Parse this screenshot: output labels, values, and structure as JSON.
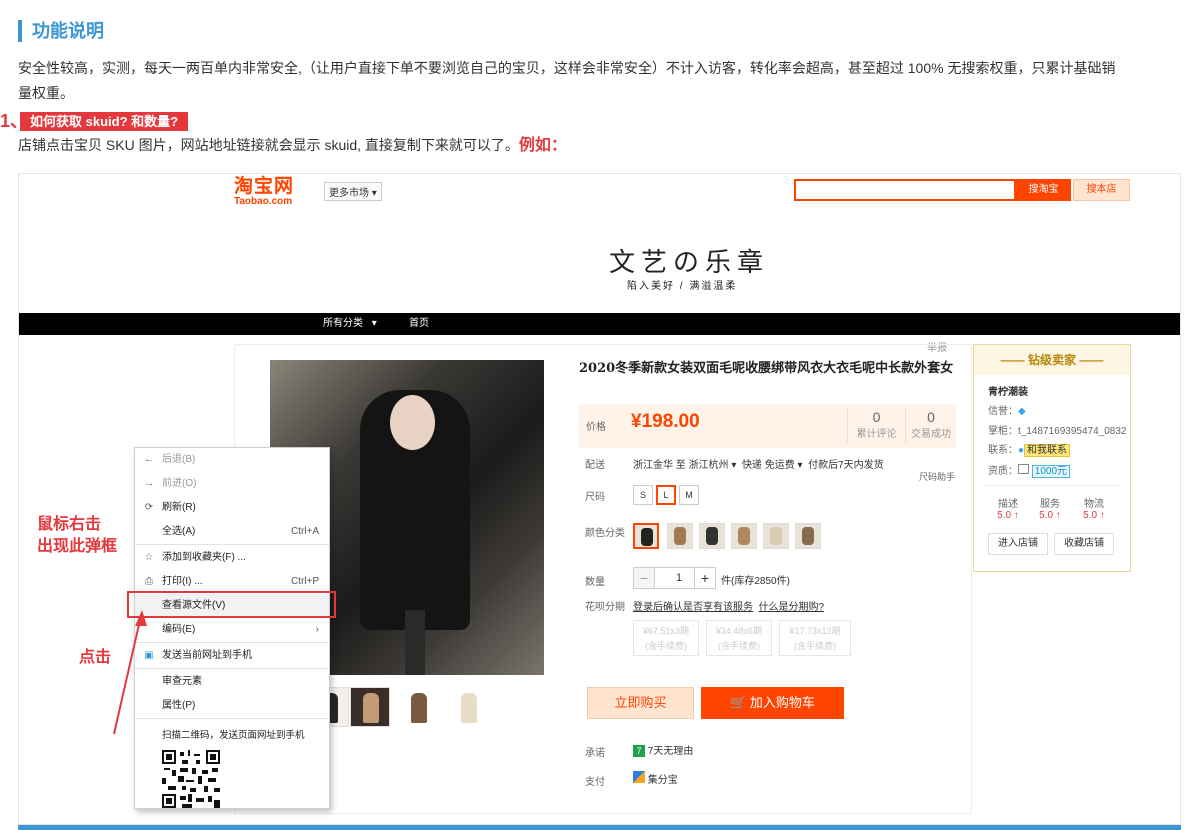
{
  "section": {
    "title": "功能说明",
    "paragraph": "安全性较高，实测，每天一两百单内非常安全,（让用户直接下单不要浏览自己的宝贝，这样会非常安全）不计入访客，转化率会超高，甚至超过 100% 无搜索权重，只累计基础销量权重。",
    "step_number": "1、",
    "step_badge": "如何获取 skuid? 和数量?",
    "step_text": "店铺点击宝贝 SKU 图片，网站地址链接就会显示 skuid, 直接复制下来就可以了。",
    "example_label": "例如："
  },
  "taobao": {
    "logo_cn": "淘宝网",
    "logo_en": "Taobao.com",
    "more_market": "更多市场",
    "search_placeholder": "",
    "search_button": "搜淘宝",
    "store_button": "搜本店",
    "shop_name": "文艺の乐章",
    "shop_slogan": "陷入美好 / 满溢温柔",
    "nav": [
      "所有分类",
      "首页"
    ],
    "report": "举报"
  },
  "product": {
    "title": "2020冬季新款女装双面毛呢收腰绑带风衣大衣毛呢中长款外套女",
    "price_label": "价格",
    "price": "¥198.00",
    "review_count": "0",
    "review_label": "累计评论",
    "sales_count": "0",
    "sales_label": "交易成功",
    "delivery_label": "配送",
    "delivery_from": "浙江金华 至",
    "delivery_to": "浙江杭州",
    "delivery_express": "快递 免运费",
    "delivery_time": "付款后7天内发货",
    "size_helper": "尺码助手",
    "size_label": "尺码",
    "sizes": [
      "S",
      "L",
      "M"
    ],
    "color_label": "颜色分类",
    "qty_label": "数量",
    "qty_minus": "−",
    "qty_value": "1",
    "qty_plus": "+",
    "qty_stock": "件(库存2850件)",
    "installment_label": "花呗分期",
    "installment_text": "登录后确认是否享有该服务",
    "installment_link": "什么是分期购?",
    "installments": [
      {
        "amount": "¥67.51x3期",
        "fee": "(含手续费)"
      },
      {
        "amount": "¥34.48x6期",
        "fee": "(含手续费)"
      },
      {
        "amount": "¥17.73x12期",
        "fee": "(含手续费)"
      }
    ],
    "buy_now": "立即购买",
    "add_cart": "加入购物车",
    "promise_label": "承诺",
    "promise_text": "7天无理由",
    "pay_label": "支付",
    "pay_text": "集分宝"
  },
  "seller": {
    "header": "钻级卖家",
    "name": "青柠潮装",
    "credit_label": "信誉：",
    "owner_label": "掌柜：",
    "owner_value": "t_1487169395474_0832",
    "contact_label": "联系：",
    "contact_value": "和我联系",
    "qual_label": "资质：",
    "qual_value": "1000元",
    "scores": [
      {
        "label": "描述",
        "value": "5.0 ↑"
      },
      {
        "label": "服务",
        "value": "5.0 ↑"
      },
      {
        "label": "物流",
        "value": "5.0 ↑"
      }
    ],
    "enter_store": "进入店铺",
    "fav_store": "收藏店铺"
  },
  "context_menu": {
    "items": [
      {
        "icon": "←",
        "label": "后退(B)"
      },
      {
        "icon": "→",
        "label": "前进(O)"
      },
      {
        "icon": "⟳",
        "label": "刷新(R)"
      },
      {
        "label": "全选(A)",
        "shortcut": "Ctrl+A"
      },
      {
        "icon": "☆",
        "label": "添加到收藏夹(F) ..."
      },
      {
        "icon": "⎙",
        "label": "打印(I) ...",
        "shortcut": "Ctrl+P"
      },
      {
        "label": "查看源文件(V)"
      },
      {
        "label": "编码(E)",
        "arrow": "›"
      },
      {
        "icon": "▣",
        "label": "发送当前网址到手机"
      },
      {
        "label": "审查元素"
      },
      {
        "label": "属性(P)"
      },
      {
        "label": "扫描二维码，发送页面网址到手机"
      }
    ]
  },
  "annotations": {
    "right_click_line1": "鼠标右击",
    "right_click_line2": "出现此弹框",
    "click": "点击"
  },
  "colors": {
    "accent_blue": "#3a97d4",
    "accent_red": "#e4393c",
    "taobao_orange": "#ff4400"
  }
}
